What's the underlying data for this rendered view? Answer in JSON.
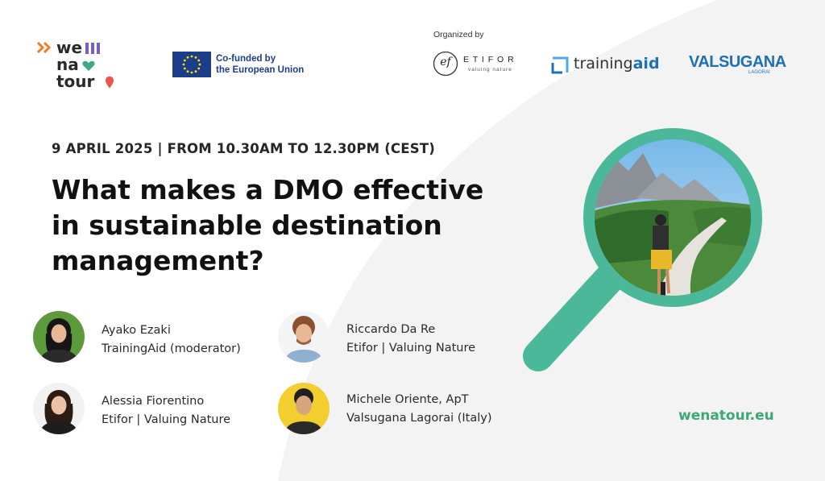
{
  "branding": {
    "wenatour_lines": [
      "we",
      "na",
      "tour"
    ],
    "eu_line1": "Co-funded by",
    "eu_line2": "the European Union",
    "organized_by": "Organized by",
    "etifor_mark": "ef",
    "etifor_name": "E T I F O R",
    "etifor_tagline": "valuing nature",
    "trainingaid_text": "trainingaid",
    "trainingaid_plain": "training",
    "trainingaid_bold": "aid",
    "valsugana_text": "VALSUGANA",
    "valsugana_sub": "LAGORAI"
  },
  "event": {
    "date": "9 APRIL 2025 | FROM 10.30AM TO 12.30PM (CEST)",
    "title_lines": [
      "What makes a DMO effective",
      "in sustainable destination",
      "management?"
    ]
  },
  "speakers": [
    {
      "name": "Ayako Ezaki",
      "org": "TrainingAid (moderator)"
    },
    {
      "name": "Alessia Fiorentino",
      "org": "Etifor | Valuing Nature"
    },
    {
      "name": "Riccardo Da Re",
      "org": "Etifor | Valuing Nature"
    },
    {
      "name": "Michele Oriente, ApT",
      "org": "Valsugana Lagorai (Italy)"
    }
  ],
  "website": "wenatour.eu",
  "colors": {
    "accent_green": "#3cab7d",
    "teal": "#4bb89a",
    "eu_blue": "#1c3e8a",
    "eu_yellow": "#ffdd00",
    "orange": "#f07c2a",
    "purple": "#7a5cc9",
    "trainingaid_blue": "#1f6fb5"
  }
}
